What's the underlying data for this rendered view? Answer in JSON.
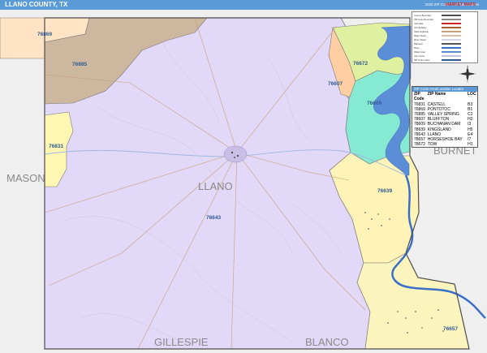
{
  "header": {
    "title": "LLANO COUNTY, TX",
    "edition": "2020 ZIP Code ColorCast Edition"
  },
  "county_names": {
    "llano": "LLANO",
    "mason": "MASON",
    "burnet": "BURNET",
    "gillespie": "GILLESPIE",
    "blanco": "BLANCO"
  },
  "zip_labels": [
    "76869",
    "76885",
    "76831",
    "76672",
    "76607",
    "76609",
    "76643",
    "76639",
    "76657"
  ],
  "zip_index": {
    "header": "ZIP Code Area/Location Locator",
    "columns": [
      "ZIP Code",
      "ZIP Name",
      "LOC"
    ],
    "rows": [
      [
        "76831",
        "CASTELL",
        "B3"
      ],
      [
        "76869",
        "PONTOTOC",
        "B1"
      ],
      [
        "76885",
        "VALLEY SPRING",
        "C2"
      ],
      [
        "78607",
        "BLUFFTON",
        "H2"
      ],
      [
        "78609",
        "BUCHANAN DAM",
        "I3"
      ],
      [
        "78639",
        "KINGSLAND",
        "H5"
      ],
      [
        "78643",
        "LLANO",
        "E4"
      ],
      [
        "78657",
        "HORSESHOE BAY",
        "I7"
      ],
      [
        "78672",
        "TOW",
        "H1"
      ]
    ]
  },
  "legend": {
    "rows": [
      "County Boundary",
      "ZIP Code Boundary",
      "Interstate",
      "US Highway",
      "State Highway",
      "Major Road",
      "Minor Road",
      "Railroad",
      "River",
      "Water Area",
      "City Limits",
      "ZIP Code Label"
    ],
    "colors": {
      "zip_76869": "#ffe3c5",
      "zip_76885": "#cdb79e",
      "zip_76831": "#fff6b4",
      "zip_78643": "#e2d8f7",
      "zip_78672": "#dff0a0",
      "zip_78607": "#ffcfa3",
      "zip_78609": "#86ead2",
      "zip_78639": "#fff3b8",
      "zip_78657": "#fcf4bd",
      "outside": "#eeeeee",
      "water": "#5b8ed6",
      "title_bar": "#5a9ad6",
      "label": "#2f5a92"
    }
  },
  "brand": "MARKET MAPS",
  "compass_letters": [
    "N",
    "S",
    "E",
    "W"
  ]
}
